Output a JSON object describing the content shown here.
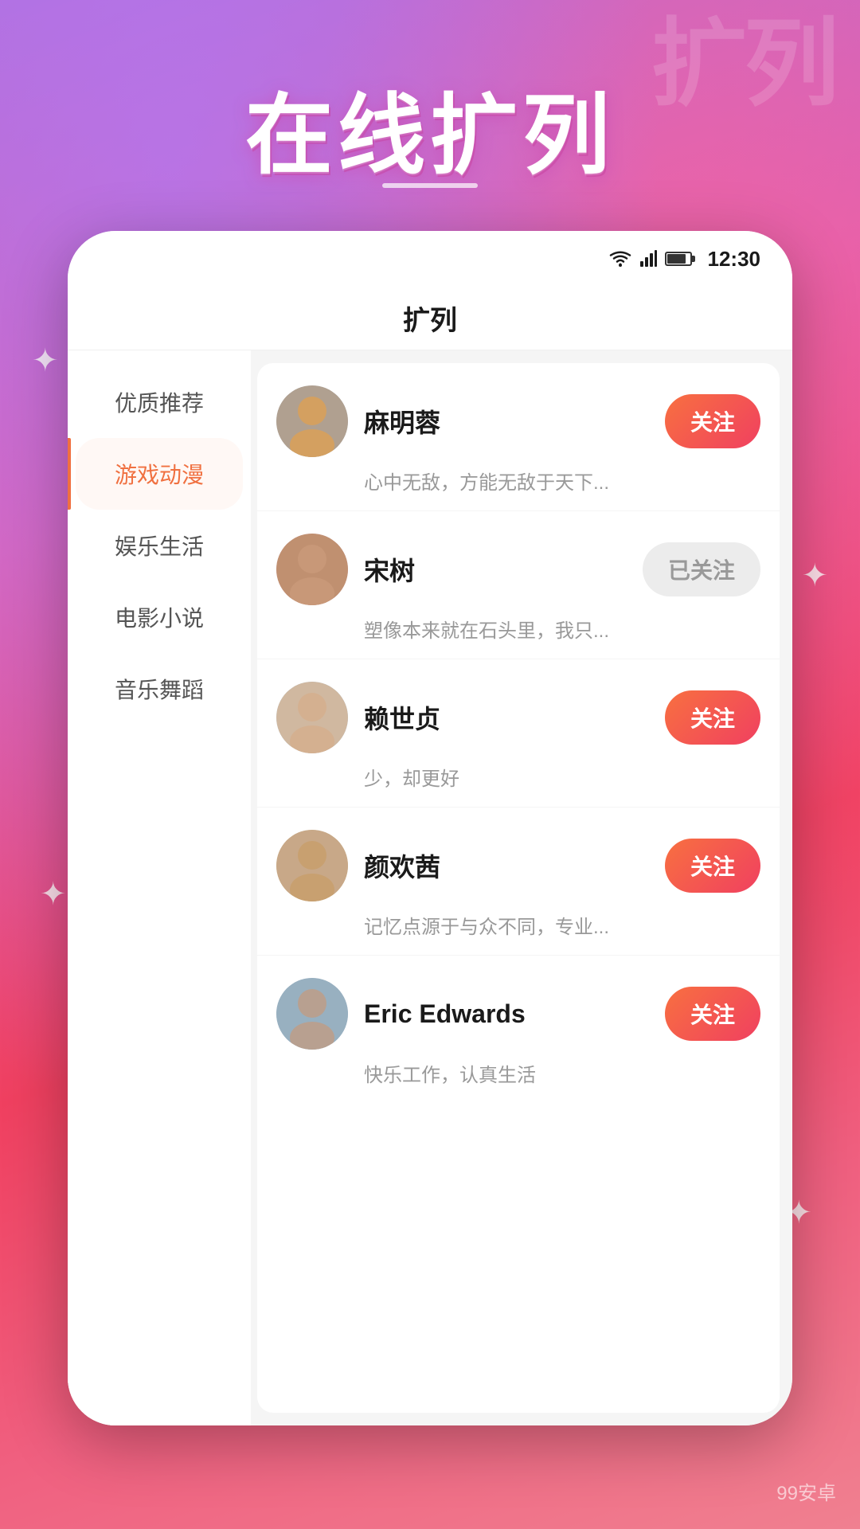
{
  "background": {
    "watermark": "扩列"
  },
  "main_title": "在线扩列",
  "status_bar": {
    "time": "12:30"
  },
  "page_header": {
    "title": "扩列"
  },
  "sidebar": {
    "items": [
      {
        "id": "quality",
        "label": "优质推荐",
        "active": false
      },
      {
        "id": "game",
        "label": "游戏动漫",
        "active": true
      },
      {
        "id": "entertainment",
        "label": "娱乐生活",
        "active": false
      },
      {
        "id": "movie",
        "label": "电影小说",
        "active": false
      },
      {
        "id": "music",
        "label": "音乐舞蹈",
        "active": false
      }
    ]
  },
  "users": [
    {
      "name": "麻明蓉",
      "bio": "心中无敌，方能无敌于天下...",
      "follow_status": "unfollow",
      "follow_label": "关注",
      "avatar_class": "avatar-1"
    },
    {
      "name": "宋树",
      "bio": "塑像本来就在石头里，我只...",
      "follow_status": "following",
      "follow_label": "已关注",
      "avatar_class": "avatar-2"
    },
    {
      "name": "赖世贞",
      "bio": "少，却更好",
      "follow_status": "unfollow",
      "follow_label": "关注",
      "avatar_class": "avatar-3"
    },
    {
      "name": "颜欢茜",
      "bio": "记忆点源于与众不同，专业...",
      "follow_status": "unfollow",
      "follow_label": "关注",
      "avatar_class": "avatar-4"
    },
    {
      "name": "Eric Edwards",
      "bio": "快乐工作，认真生活",
      "follow_status": "unfollow",
      "follow_label": "关注",
      "avatar_class": "avatar-5"
    }
  ],
  "bottom_watermark": "99安卓"
}
